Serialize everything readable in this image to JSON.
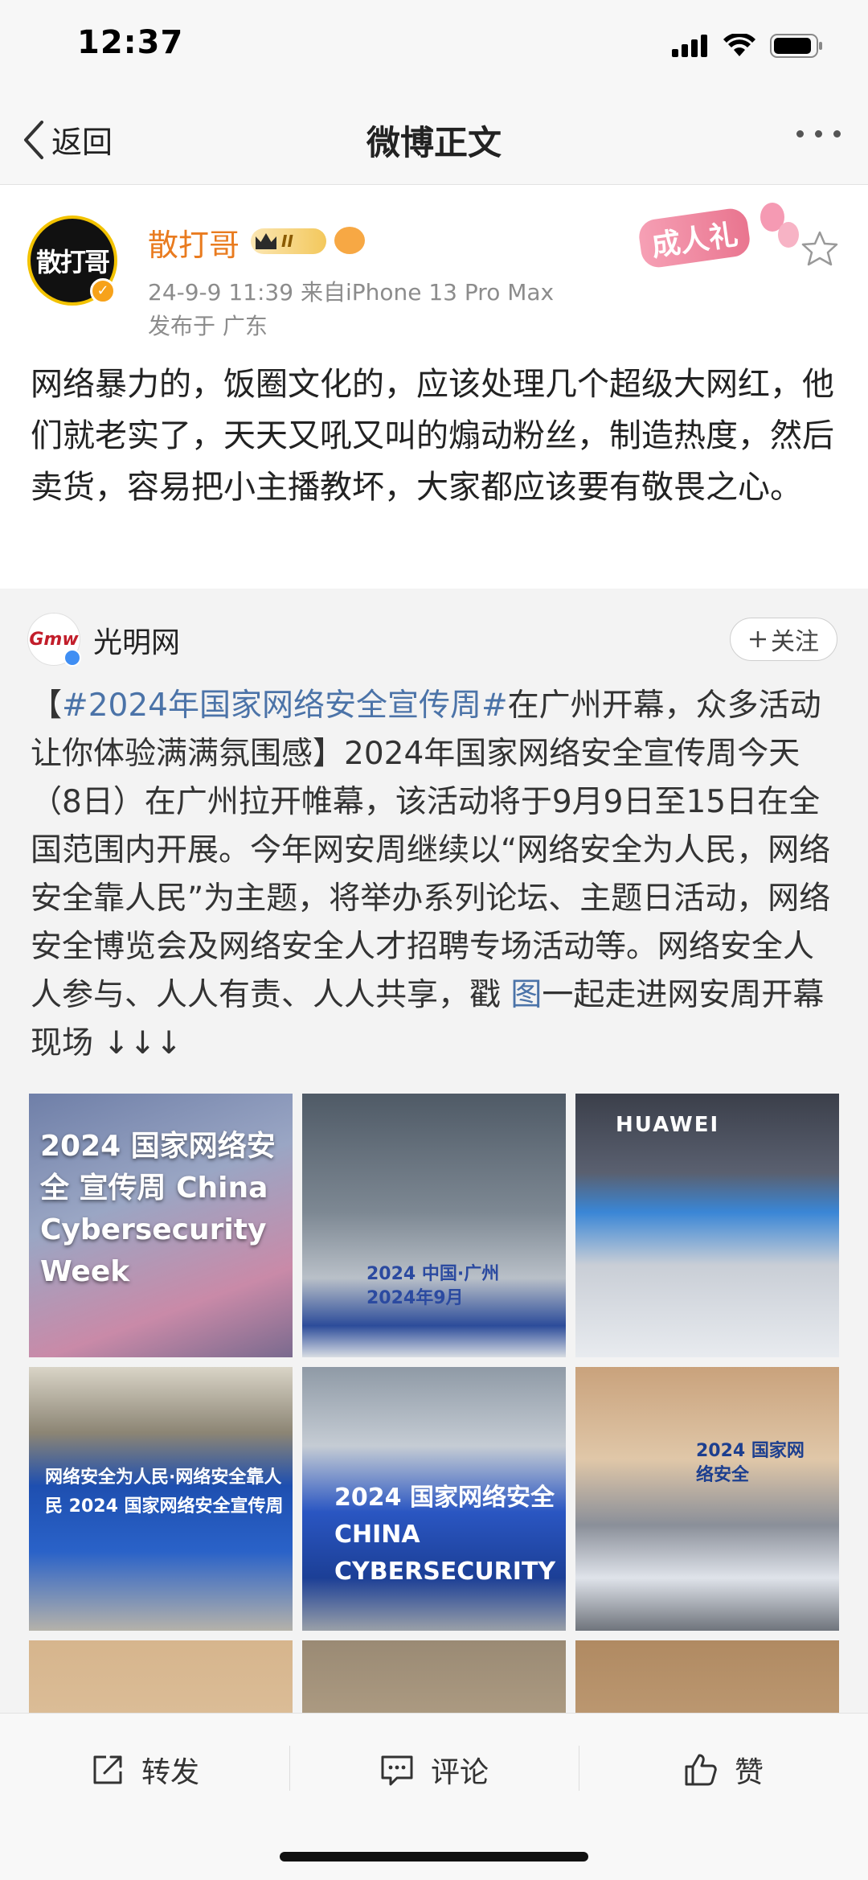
{
  "status_bar": {
    "time": "12:37"
  },
  "nav": {
    "back_label": "返回",
    "title": "微博正文"
  },
  "post": {
    "author": "散打哥",
    "avatar_text": "散打哥",
    "vip_level": "II",
    "badge_label": "成人礼",
    "time_source": "24-9-9 11:39  来自iPhone 13 Pro Max",
    "location": "发布于 广东",
    "content": "网络暴力的，饭圈文化的，应该处理几个超级大网红，他们就老实了，天天又吼又叫的煽动粉丝，制造热度，然后卖货，容易把小主播教坏，大家都应该要有敬畏之心。"
  },
  "retweet": {
    "author": "光明网",
    "avatar_text": "Gmw",
    "follow_label": "关注",
    "text_open": "【",
    "hashtag": "#2024年国家网络安全宣传周#",
    "text_main": "在广州开幕，众多活动让你体验满满氛围感】2024年国家网络安全宣传周今天（8日）在广州拉开帷幕，该活动将于9月9日至15日在全国范围内开展。今年网安周继续以“网络安全为人民，网络安全靠人民”为主题，将举办系列论坛、主题日活动，网络安全博览会及网络安全人才招聘专场活动等。网络安全人人参与、人人有责、人人共享，戳 ",
    "image_link": "图",
    "text_tail": "一起走进网安周开幕现场 ↓↓↓",
    "photos": [
      {
        "caption": "2024 国家网络安全 宣传周 China Cybersecurity Week"
      },
      {
        "caption": "2024 中国·广州 2024年9月"
      },
      {
        "caption": "HUAWEI"
      },
      {
        "caption": "网络安全为人民·网络安全靠人民 2024 国家网络安全宣传周"
      },
      {
        "caption": "2024 国家网络安全 CHINA CYBERSECURITY"
      },
      {
        "caption": "2024 国家网络安全"
      },
      {
        "caption": ""
      },
      {
        "caption": ""
      },
      {
        "caption": ""
      }
    ]
  },
  "toolbar": {
    "repost": "转发",
    "comment": "评论",
    "like": "赞"
  }
}
